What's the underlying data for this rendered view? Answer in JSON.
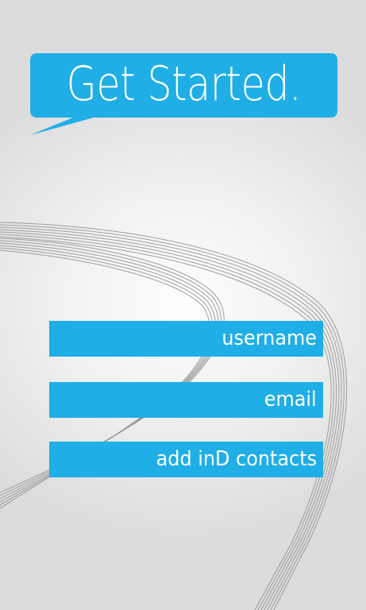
{
  "header": {
    "title": "Get Started."
  },
  "form": {
    "fields": [
      {
        "label": "username"
      },
      {
        "label": "email"
      },
      {
        "label": "add inD contacts"
      }
    ]
  },
  "colors": {
    "accent": "#1faee6",
    "text_on_accent": "#ffffff",
    "swoosh_lines": "#8a8a8a"
  }
}
